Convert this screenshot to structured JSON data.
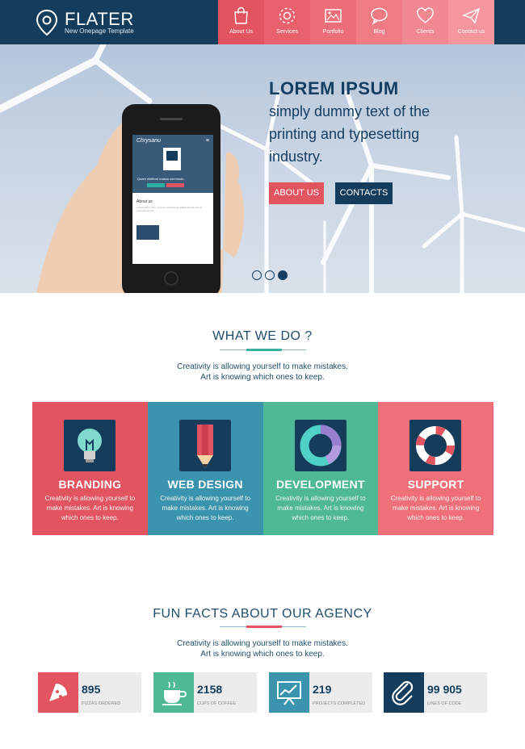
{
  "header": {
    "brand_name": "FLATER",
    "brand_subtitle": "New Onepage Template",
    "nav": [
      {
        "label": "About Us",
        "icon": "bag-icon",
        "color": "#e25460"
      },
      {
        "label": "Services",
        "icon": "gear-icon",
        "color": "#e8616c"
      },
      {
        "label": "Portfolio",
        "icon": "image-icon",
        "color": "#ec6e78"
      },
      {
        "label": "Blog",
        "icon": "speech-bubble-icon",
        "color": "#ef7b84"
      },
      {
        "label": "Clients",
        "icon": "heart-icon",
        "color": "#f28891"
      },
      {
        "label": "Contact us",
        "icon": "paper-plane-icon",
        "color": "#f5959d"
      }
    ]
  },
  "hero": {
    "title": "LOREM IPSUM",
    "subtitle": "simply dummy text of the printing and typesetting industry.",
    "about_button": "ABOUT US",
    "contacts_button": "CONTACTS",
    "slides": 3,
    "active_slide": 3,
    "phone": {
      "logo": "Chrysanu",
      "tagline": "Quam eleifend massa commodo",
      "about_label": "About us",
      "about_text": "Lorem ipsum dolor sit amet consectetur adipiscing elit sed do eiusmod tempor"
    }
  },
  "what_we_do": {
    "title": "WHAT WE DO ?",
    "desc_line1": "Creativity is allowing yourself to make mistakes.",
    "desc_line2": "Art is knowing which ones to keep.",
    "accent": "#3ab3a3",
    "services": [
      {
        "title": "BRANDING",
        "desc": "Creativity is allowing yourself to make mistakes. Art is knowing which ones to keep.",
        "color": "#e25460",
        "icon": "lightbulb-icon"
      },
      {
        "title": "WEB DESIGN",
        "desc": "Creativity is allowing yourself to make mistakes. Art is knowing which ones to keep.",
        "color": "#3b94ad",
        "icon": "pencil-icon"
      },
      {
        "title": "DEVELOPMENT",
        "desc": "Creativity is allowing yourself to make mistakes. Art is knowing which ones to keep.",
        "color": "#4fb995",
        "icon": "donut-chart-icon"
      },
      {
        "title": "SUPPORT",
        "desc": "Creativity is allowing yourself to make mistakes. Art is knowing which ones to keep.",
        "color": "#ef7078",
        "icon": "lifebuoy-icon"
      }
    ]
  },
  "fun_facts": {
    "title": "FUN FACTS ABOUT OUR AGENCY",
    "desc_line1": "Creativity is allowing yourself to make mistakes.",
    "desc_line2": "Art is knowing which ones to keep.",
    "accent": "#e25460",
    "facts": [
      {
        "value": "895",
        "label": "PIZZAS ORDERED",
        "color": "#e25460",
        "icon": "pizza-icon"
      },
      {
        "value": "2158",
        "label": "CUPS OF COFFEE",
        "color": "#4fb995",
        "icon": "coffee-cup-icon"
      },
      {
        "value": "219",
        "label": "PROJECTS COMPLETED",
        "color": "#3b94ad",
        "icon": "presentation-chart-icon"
      },
      {
        "value": "99 905",
        "label": "LINES OF CODE",
        "color": "#143c5c",
        "icon": "paperclip-icon"
      }
    ]
  }
}
